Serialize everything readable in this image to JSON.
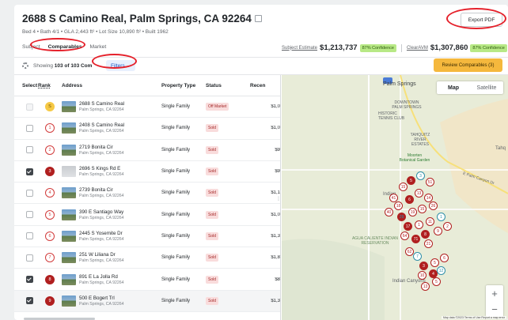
{
  "header": {
    "title": "2688 S Camino Real, Palm Springs, CA 92264",
    "subinfo": "Bed 4 • Bath 4/1 • GLA 2,443 ft² • Lot Size 10,890 ft² • Built 1962",
    "export_label": "Export PDF"
  },
  "tabs": [
    {
      "label": "Subject"
    },
    {
      "label": "Comparables"
    },
    {
      "label": "Market"
    }
  ],
  "estimates": {
    "subject_label": "Subject Estimate",
    "subject_value": "$1,213,737",
    "subject_conf": "87% Confidence",
    "clear_label": "ClearAVM",
    "clear_value": "$1,307,860",
    "clear_conf": "87% Confidence"
  },
  "toolbar": {
    "showing_prefix": "Showing",
    "showing_count": "103 of 103 Com",
    "filters_label": "Filters ⌄",
    "review_label": "Review Comparables (3)"
  },
  "table": {
    "columns": [
      "Select",
      "Rank",
      "Address",
      "Property Type",
      "Status",
      "Recen"
    ],
    "rows": [
      {
        "rank": "S",
        "addr1": "2688 S Camino Real",
        "addr2": "Palm Springs, CA 92264",
        "type": "Single Family",
        "status": "Off Market",
        "recent": "$1,0"
      },
      {
        "rank": "1",
        "addr1": "2408 S Camino Real",
        "addr2": "Palm Springs, CA 92264",
        "type": "Single Family",
        "status": "Sold",
        "recent": "$1,0"
      },
      {
        "rank": "2",
        "addr1": "2719 Bonita Cir",
        "addr2": "Palm Springs, CA 92264",
        "type": "Single Family",
        "status": "Sold",
        "recent": "$9"
      },
      {
        "rank": "3",
        "addr1": "2696 S Kings Rd E",
        "addr2": "Palm Springs, CA 92264",
        "type": "Single Family",
        "status": "Sold",
        "recent": "$9"
      },
      {
        "rank": "4",
        "addr1": "2739 Bonita Cir",
        "addr2": "Palm Springs, CA 92264",
        "type": "Single Family",
        "status": "Sold",
        "recent": "$1,1"
      },
      {
        "rank": "5",
        "addr1": "390 E Santiago Way",
        "addr2": "Palm Springs, CA 92264",
        "type": "Single Family",
        "status": "Sold",
        "recent": "$1,0"
      },
      {
        "rank": "6",
        "addr1": "2445 S Yosemite Dr",
        "addr2": "Palm Springs, CA 92264",
        "type": "Single Family",
        "status": "Sold",
        "recent": "$1,3"
      },
      {
        "rank": "7",
        "addr1": "251 W Liliana Dr",
        "addr2": "Palm Springs, CA 92264",
        "type": "Single Family",
        "status": "Sold",
        "recent": "$1,8"
      },
      {
        "rank": "8",
        "addr1": "891 E La Jolla Rd",
        "addr2": "Palm Springs, CA 92264",
        "type": "Single Family",
        "status": "Sold",
        "recent": "$8"
      },
      {
        "rank": "9",
        "addr1": "500 E Bogert Trl",
        "addr2": "Palm Springs, CA 92264",
        "type": "Single Family",
        "status": "Sold",
        "recent": "$1,3"
      }
    ]
  },
  "map": {
    "type_map": "Map",
    "type_satellite": "Satellite",
    "labels": {
      "palm_springs": "Palm Springs",
      "downtown": "DOWNTOWN PALM SPRINGS",
      "historic": "HISTORIC TENNIS CLUB",
      "tahquitz": "TAHQUITZ RIVER ESTATES",
      "mooten": "Moorten Botanical Garden",
      "tahq": "Tahq",
      "indian": "Indian",
      "agua": "AGUA CALIENTE INDIAN RESERVATION",
      "canyons": "Indian Canyons",
      "road": "E Palm Canyon Dr",
      "attribution": "Map data ©2023   Terms of Use   Report a map error"
    },
    "zoom_in": "+",
    "zoom_out": "−",
    "pins": [
      "41",
      "15",
      "5",
      "3",
      "51",
      "18",
      "6",
      "13",
      "14",
      "40",
      "29",
      "19",
      "15",
      "26",
      "17",
      "1",
      "11",
      "1",
      "8",
      "9",
      "2",
      "64",
      "71",
      "21",
      "7",
      "62",
      "3",
      "5",
      "6",
      "10",
      "4",
      "12",
      "13",
      "5"
    ]
  },
  "colors": {
    "accent_orange": "#f5b83d",
    "confidence_green": "#b8e986",
    "sold_pink": "#f9dcdc",
    "pin_red": "#b01f1f",
    "annotation_red": "#e5212b"
  }
}
